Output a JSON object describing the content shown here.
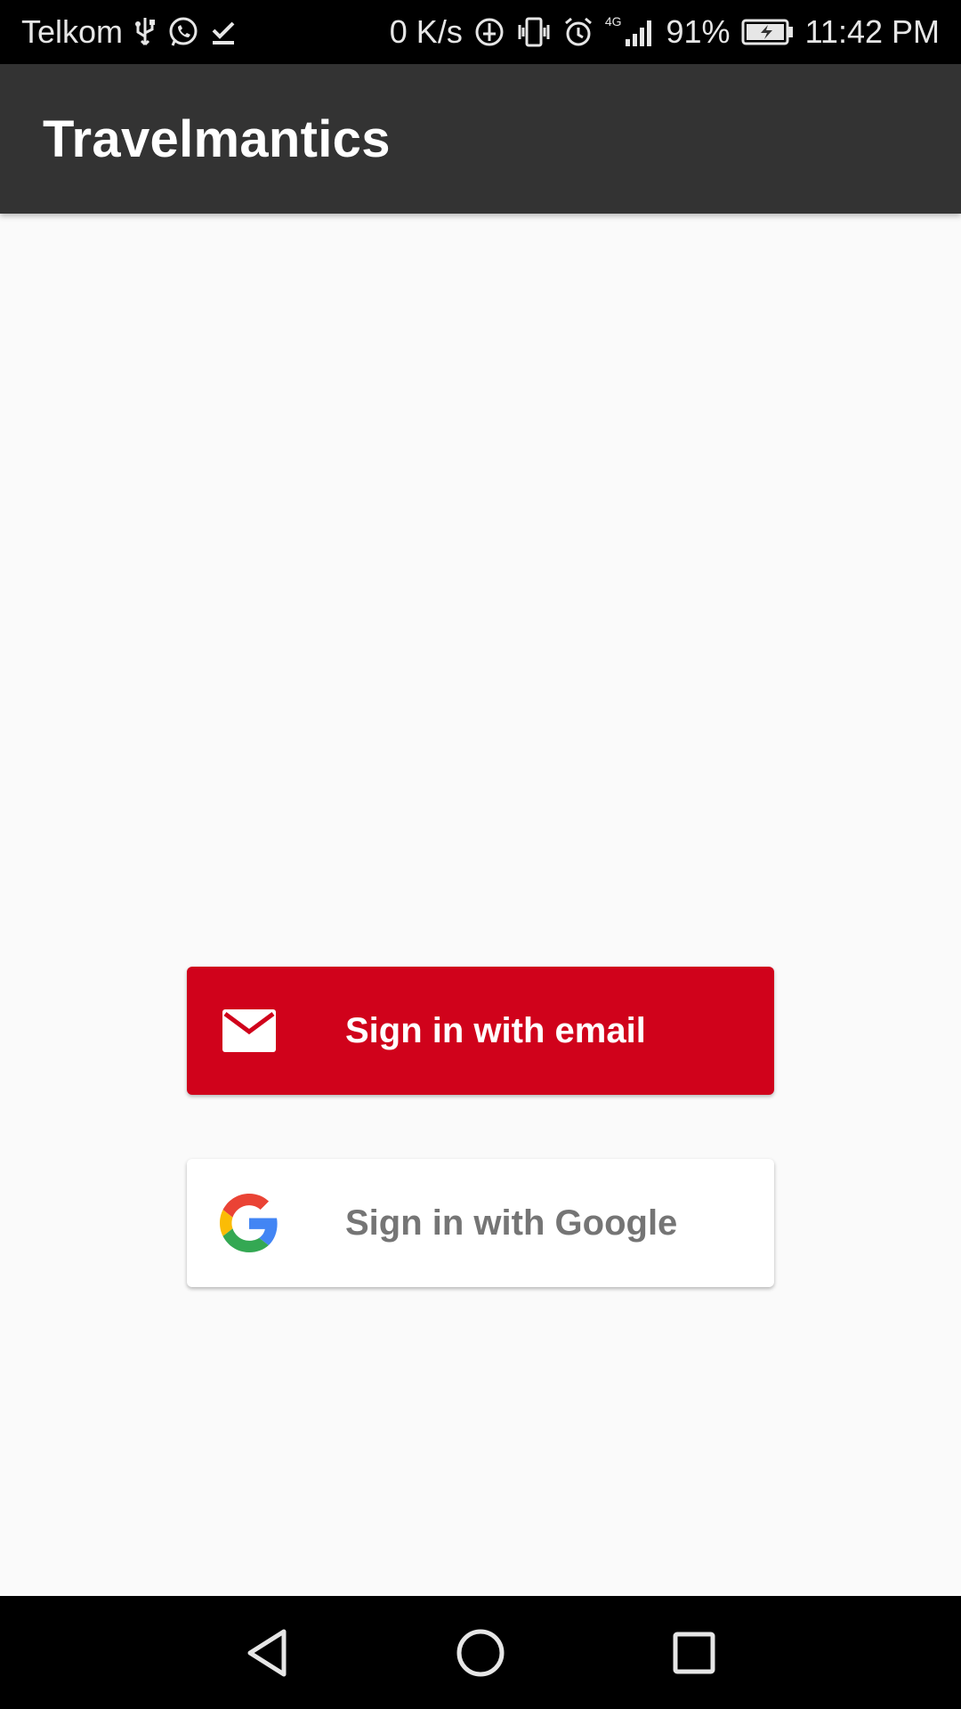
{
  "status_bar": {
    "carrier": "Telkom",
    "net_speed": "0 K/s",
    "network_type": "4G",
    "battery_percent": "91%",
    "time": "11:42 PM",
    "left_icons": [
      "usb-icon",
      "whatsapp-icon",
      "download-done-icon"
    ],
    "right_icons": [
      "data-saver-icon",
      "vibrate-icon",
      "alarm-icon",
      "signal-icon",
      "battery-charging-icon"
    ]
  },
  "app_bar": {
    "title": "Travelmantics",
    "background": "#333333"
  },
  "auth": {
    "email_button": {
      "label": "Sign in with email",
      "icon": "mail-icon",
      "background": "#d0021b",
      "text_color": "#ffffff"
    },
    "google_button": {
      "label": "Sign in with Google",
      "icon": "google-logo-icon",
      "background": "#ffffff",
      "text_color": "#757575"
    }
  },
  "nav_bar": {
    "buttons": [
      "back-icon",
      "home-icon",
      "recents-icon"
    ]
  }
}
